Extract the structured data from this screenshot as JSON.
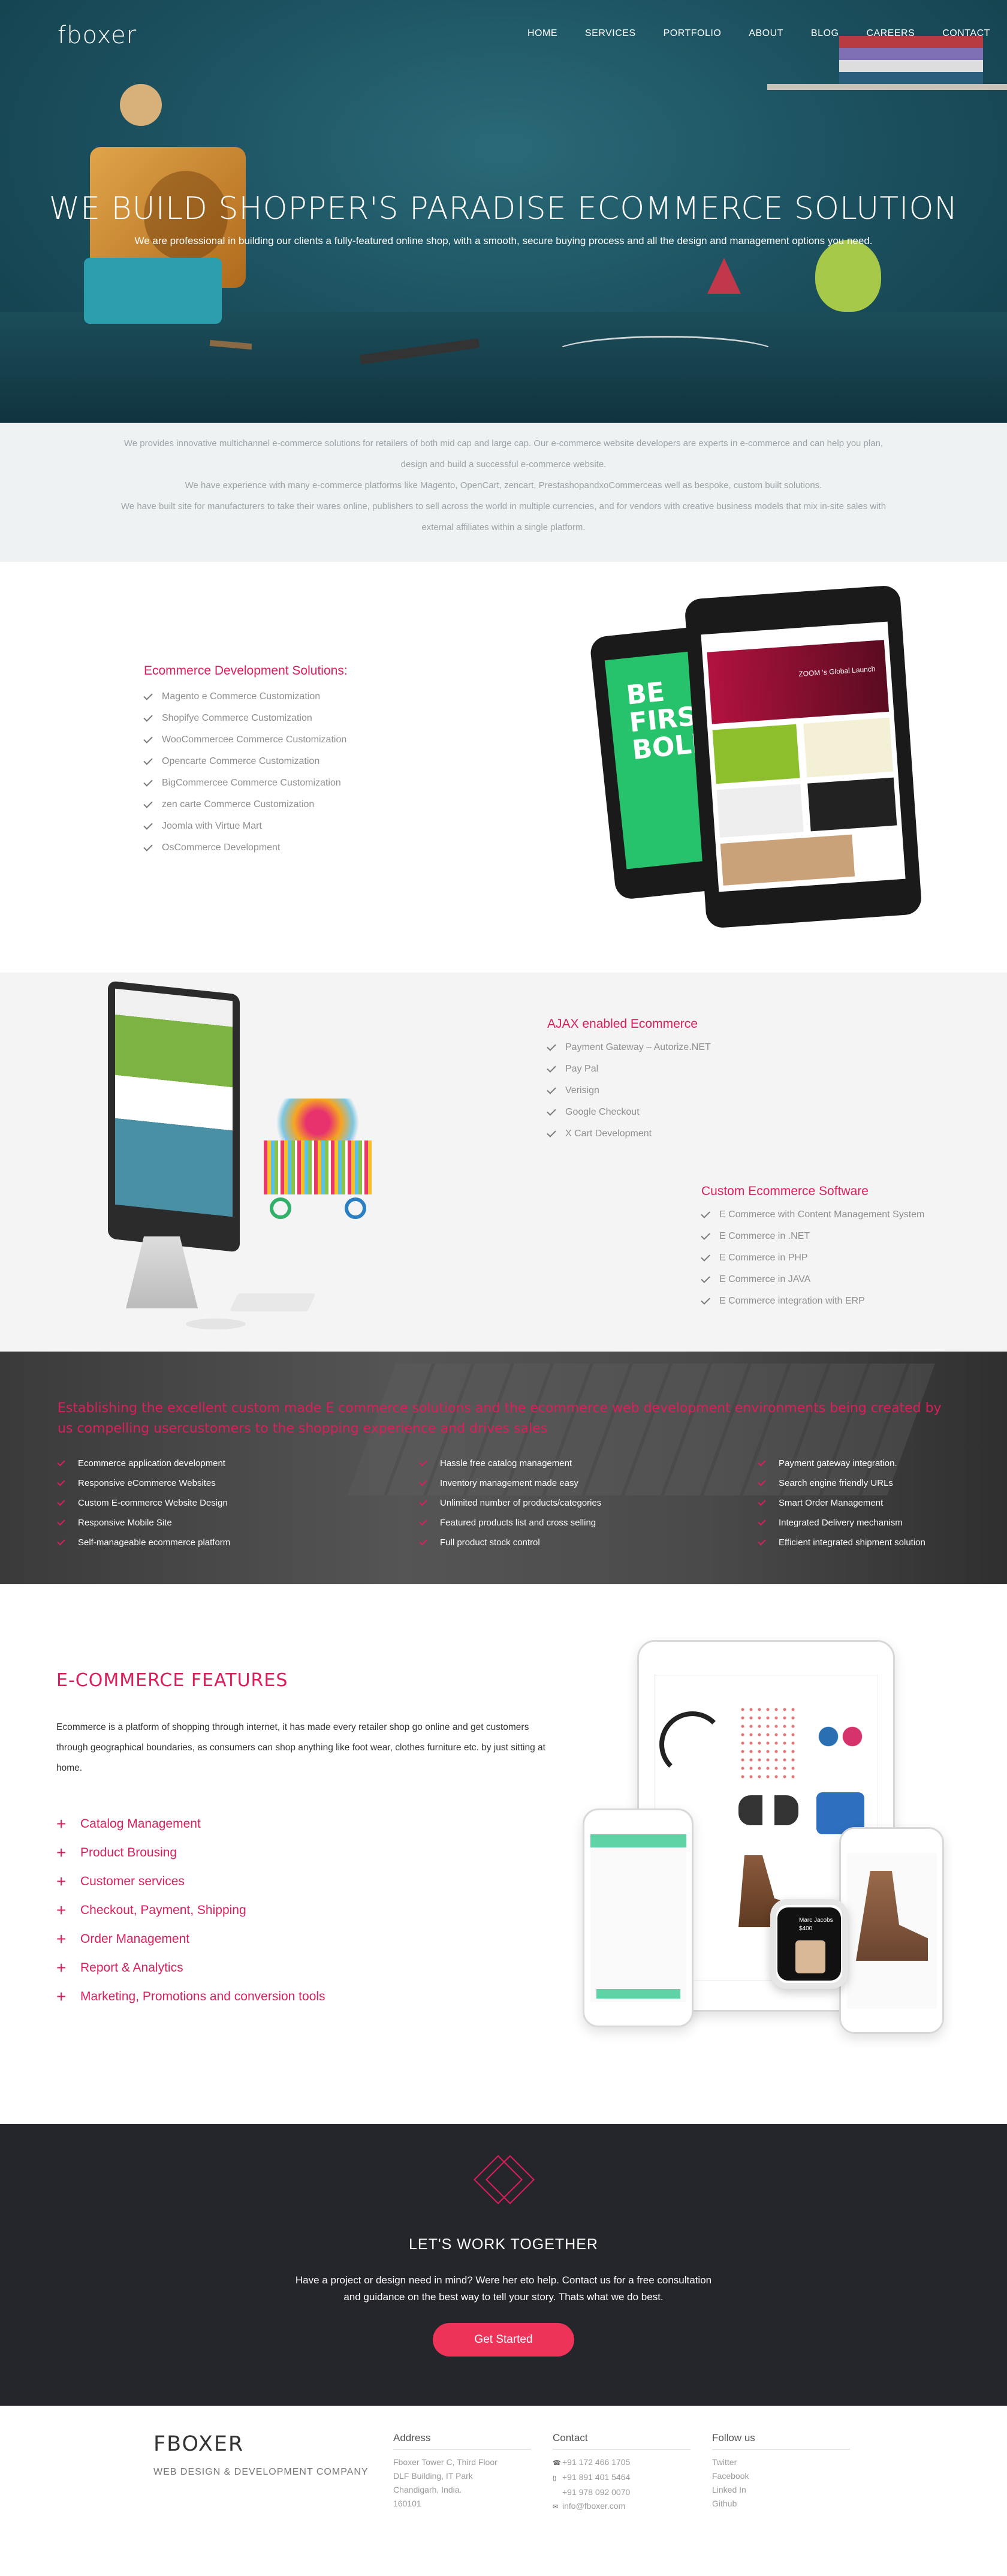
{
  "header": {
    "logo": "fboxer",
    "nav": [
      "HOME",
      "SERVICES",
      "PORTFOLIO",
      "ABOUT",
      "BLOG",
      "CAREERS",
      "CONTACT"
    ]
  },
  "hero": {
    "title": "WE BUILD SHOPPER'S PARADISE ECOMMERCE SOLUTION",
    "subtitle": "We are professional in building our clients a fully-featured online shop, with a smooth, secure buying process and all the design and management options you need."
  },
  "intro": {
    "line1": "We provides innovative multichannel e-commerce solutions for retailers of both mid cap and large cap. Our e-commerce website developers are experts in e-commerce and can help you plan,",
    "line2": "design and build a successful e-commerce website.",
    "line3": "We have experience with many e-commerce platforms like Magento, OpenCart, zencart, PrestashopandxoCommerceas well as bespoke, custom built solutions.",
    "line4": "We have built site for manufacturers to take their wares online, publishers to sell across the world in multiple currencies, and for vendors with creative business models that mix in-site sales with",
    "line5": "external affiliates within a single platform."
  },
  "dev": {
    "heading": "Ecommerce Development Solutions:",
    "items": [
      "Magento e Commerce Customization",
      "Shopifye Commerce Customization",
      "WooCommercee Commerce Customization",
      "Opencarte Commerce Customization",
      "BigCommercee Commerce Customization",
      "zen carte Commerce Customization",
      "Joomla with Virtue Mart",
      "OsCommerce Development"
    ],
    "tablet_text1": "BE FIRSTAN BOLD",
    "tablet_text2": "ZOOM 's Global Launch"
  },
  "ajax": {
    "heading": "AJAX enabled Ecommerce",
    "items": [
      "Payment Gateway – Autorize.NET",
      "Pay Pal",
      "Verisign",
      "Google Checkout",
      "X Cart Development"
    ],
    "heading2": "Custom Ecommerce Software",
    "items2": [
      "E Commerce with Content Management System",
      "E Commerce in .NET",
      "E Commerce in PHP",
      "E Commerce in JAVA",
      "E Commerce integration with ERP"
    ]
  },
  "why": {
    "heading": "Establishing the excellent custom made E commerce solutions and the ecommerce web development environments being created by us compelling usercustomers to the shopping experience and drives sales",
    "col1": [
      "Ecommerce application development",
      "Responsive eCommerce Websites",
      "Custom E-commerce Website Design",
      "Responsive Mobile Site",
      "Self-manageable ecommerce platform"
    ],
    "col2": [
      "Hassle free catalog management",
      "Inventory management made easy",
      "Unlimited number of products/categories",
      "Featured products list and cross selling",
      "Full product stock control"
    ],
    "col3": [
      "Payment gateway integration.",
      "Search engine friendly URLs",
      "Smart Order Management",
      "Integrated Delivery mechanism",
      "Efficient integrated shipment solution"
    ]
  },
  "features": {
    "title": "E-COMMERCE FEATURES",
    "desc": "Ecommerce is a platform of shopping through internet, it has made every retailer shop go online and get customers through geographical boundaries, as consumers can shop anything like foot wear, clothes furniture etc. by just sitting at home.",
    "items": [
      "Catalog Management",
      "Product Brousing",
      "Customer services",
      "Checkout, Payment, Shipping",
      "Order Management",
      "Report & Analytics",
      "Marketing, Promotions and conversion tools"
    ],
    "watch_text": "Marc Jacobs",
    "watch_price": "$400"
  },
  "cta": {
    "title": "LET'S WORK TOGETHER",
    "line1": "Have a project or design need in mind? Were her eto help. Contact us for a free consultation",
    "line2": "and guidance on the best way to tell your story. Thats what we do best.",
    "button": "Get Started"
  },
  "footer": {
    "brand": "FBOXER",
    "tagline": "WEB DESIGN & DEVELOPMENT COMPANY",
    "address_title": "Address",
    "address": [
      "Fboxer Tower C, Third Floor",
      "DLF Building, IT Park",
      "Chandigarh, India.",
      "160101"
    ],
    "contact_title": "Contact",
    "phone1": "+91 172 466 1705",
    "phone2": "+91 891 401 5464",
    "phone3": "+91 978 092 0070",
    "email": "info@fboxer.com",
    "follow_title": "Follow us",
    "social": [
      "Twitter",
      "Facebook",
      "Linked In",
      "Github"
    ]
  },
  "colors": {
    "accent": "#dc1e5a",
    "cta_bg": "#25252c",
    "button": "#ed3358"
  }
}
